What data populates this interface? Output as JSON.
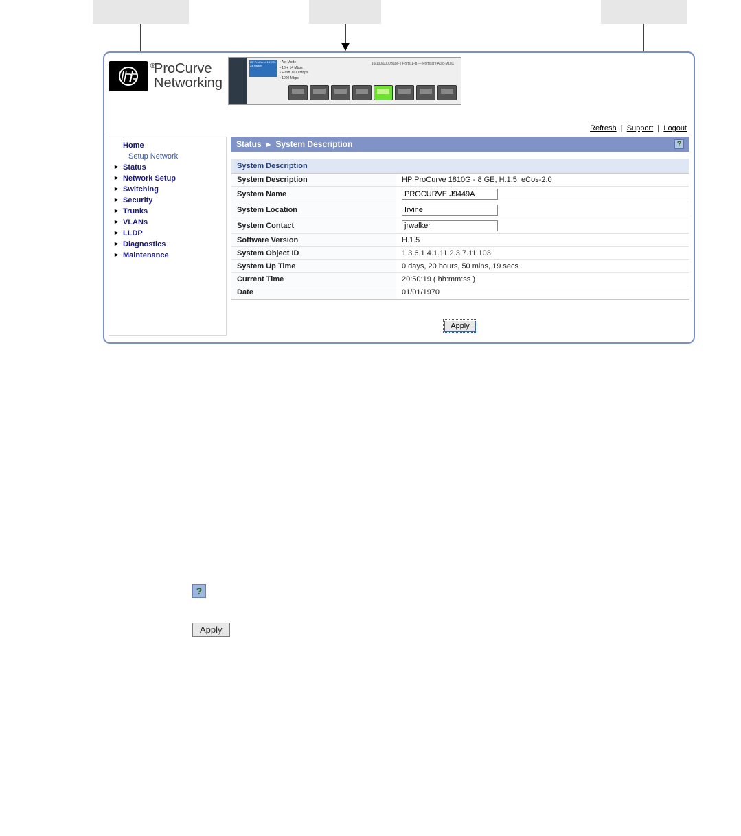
{
  "brand": {
    "line1": "ProCurve",
    "line2": "Networking"
  },
  "device": {
    "model_text": "HP ProCurve 1810G-24 Switch",
    "leds": [
      "Act Mode",
      "10 + 14 Mbps",
      "Flash 1000 Mbps",
      "1000 Mbps"
    ],
    "label": "10/100/1000Base-T Ports 1–8 — Ports are Auto-MDIX"
  },
  "top_links": {
    "refresh": "Refresh",
    "support": "Support",
    "logout": "Logout"
  },
  "nav": {
    "home": "Home",
    "home_sub": "Setup Network",
    "items": [
      "Status",
      "Network Setup",
      "Switching",
      "Security",
      "Trunks",
      "VLANs",
      "LLDP",
      "Diagnostics",
      "Maintenance"
    ]
  },
  "breadcrumb": {
    "a": "Status",
    "b": "System Description",
    "sep": "▸"
  },
  "panel": {
    "header": "System Description",
    "rows": {
      "system_description": {
        "label": "System Description",
        "value": "HP ProCurve 1810G - 8 GE, H.1.5, eCos-2.0"
      },
      "system_name": {
        "label": "System Name",
        "value": "PROCURVE J9449A"
      },
      "system_location": {
        "label": "System Location",
        "value": "Irvine"
      },
      "system_contact": {
        "label": "System Contact",
        "value": "jrwalker"
      },
      "software_version": {
        "label": "Software Version",
        "value": "H.1.5"
      },
      "system_object_id": {
        "label": "System Object ID",
        "value": "1.3.6.1.4.1.11.2.3.7.11.103"
      },
      "system_up_time": {
        "label": "System Up Time",
        "value": "0 days, 20 hours, 50 mins, 19 secs"
      },
      "current_time": {
        "label": "Current Time",
        "value": "20:50:19  ( hh:mm:ss )"
      },
      "date": {
        "label": "Date",
        "value": "01/01/1970"
      }
    }
  },
  "buttons": {
    "apply": "Apply"
  }
}
